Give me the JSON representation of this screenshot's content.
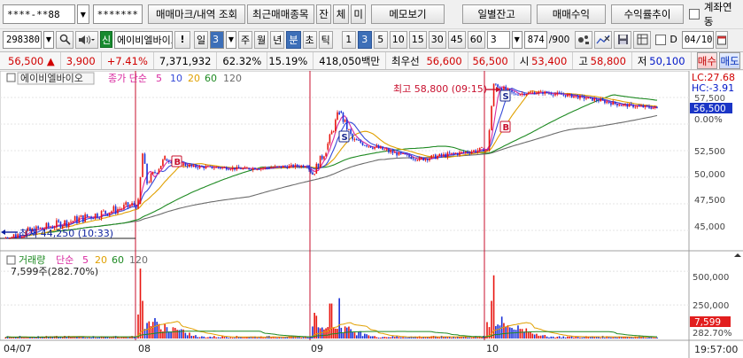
{
  "toolbar1": {
    "account": "****-**88",
    "password": "*******",
    "btn_trade_mark": "매매마크/내역 조회",
    "btn_recent": "최근매매종목",
    "btn_balance": "잔",
    "btn_conclusion": "체",
    "btn_unfilled": "미",
    "btn_memo": "메모보기",
    "btn_daily_balance": "일별잔고",
    "btn_trade_profit": "매매수익",
    "btn_profit_trend": "수익률추이",
    "account_link_label": "계좌연동"
  },
  "toolbar2": {
    "stock_code": "298380",
    "stock_badge": "신",
    "stock_name": "에이비엘바이오",
    "alert_btn": "!",
    "period_label": "일",
    "period_count": "3",
    "periods": [
      "주",
      "월",
      "년",
      "분",
      "초",
      "틱"
    ],
    "minute_values": [
      "1",
      "3",
      "5",
      "10",
      "15",
      "30",
      "45",
      "60"
    ],
    "selected_minute": "3",
    "tick_value": "3",
    "count_value": "874",
    "count_total": "/900",
    "d_label": "D",
    "date_value": "04/10"
  },
  "quote": {
    "price": "56,500",
    "change_arrow": "▲",
    "change": "3,900",
    "change_pct": "+7.41%",
    "volume": "7,371,932",
    "ratio1": "62.32%",
    "ratio2": "15.19%",
    "amount": "418,050백만",
    "best_ask_label": "최우선",
    "best_ask": "56,600",
    "best_bid": "56,500",
    "open_label": "시",
    "open": "53,400",
    "high_label": "고",
    "high": "58,800",
    "low_label": "저",
    "low": "50,100",
    "buy_btn": "매수",
    "sell_btn": "매도"
  },
  "price_panel": {
    "legend_name": "에이비엘바이오",
    "legend_ma": "종가 단순",
    "ma_periods": [
      "5",
      "10",
      "20",
      "60",
      "120"
    ],
    "lc": "LC:27.68",
    "hc": "HC:-3.91",
    "current_price_label": "56,500",
    "pct_label": "0.00%",
    "high_annotation": "최고 58,800 (09:15)",
    "low_annotation": "최저 44,250 (10:33)",
    "y_ticks": [
      "57,500",
      "52,500",
      "50,000",
      "47,500",
      "45,000"
    ]
  },
  "volume_panel": {
    "legend_name": "거래량",
    "legend_ma": "단순",
    "ma_periods": [
      "5",
      "20",
      "60",
      "120"
    ],
    "info": "7,599주(282.70%)",
    "y_ticks": [
      "500,000",
      "250,000"
    ],
    "current_label": "7,599",
    "pct_label": "282.70%"
  },
  "x_axis": {
    "labels": [
      "04/07",
      "08",
      "09",
      "10"
    ],
    "time_label": "19:57:00"
  },
  "colors": {
    "candle_up": "#e8150f",
    "candle_down": "#1a31d8",
    "ma5": "#d92aa0",
    "ma10": "#3449d8",
    "ma20": "#e0a000",
    "ma60": "#1e8a22",
    "ma120": "#6b6b6b",
    "day_separator": "#c8102e",
    "current_price_bg": "#1a35c6",
    "volume_current_bg": "#e21e1e"
  },
  "chart_data": {
    "type": "candlestick",
    "title": "",
    "price_series": [
      {
        "x": "04/07",
        "price": 44250
      },
      {
        "x": "04/08 09:00",
        "price": 47500
      },
      {
        "x": "04/08 09:10",
        "price": 52200
      },
      {
        "x": "04/08 09:20",
        "price": 49500
      },
      {
        "x": "04/08 10:00",
        "price": 51700
      },
      {
        "x": "04/08 11:00",
        "price": 51000
      },
      {
        "x": "04/08 13:00",
        "price": 50800
      },
      {
        "x": "04/08 15:20",
        "price": 51100
      },
      {
        "x": "04/09 09:00",
        "price": 50300
      },
      {
        "x": "04/09 09:30",
        "price": 52600
      },
      {
        "x": "04/09 10:00",
        "price": 56200
      },
      {
        "x": "04/09 10:30",
        "price": 53500
      },
      {
        "x": "04/09 12:00",
        "price": 52300
      },
      {
        "x": "04/09 13:00",
        "price": 51700
      },
      {
        "x": "04/09 15:20",
        "price": 52600
      },
      {
        "x": "04/10 09:00",
        "price": 52500
      },
      {
        "x": "04/10 09:15",
        "price": 58800
      },
      {
        "x": "04/10 10:00",
        "price": 57800
      },
      {
        "x": "04/10 11:00",
        "price": 58000
      },
      {
        "x": "04/10 12:00",
        "price": 57700
      },
      {
        "x": "04/10 13:00",
        "price": 57300
      },
      {
        "x": "04/10 14:00",
        "price": 56800
      },
      {
        "x": "04/10 15:20",
        "price": 56500
      }
    ],
    "volume_series": [
      {
        "x": "04/08 09:05",
        "volume": 520000
      },
      {
        "x": "04/08 09:10",
        "volume": 280000
      },
      {
        "x": "04/09 09:40",
        "volume": 260000
      },
      {
        "x": "04/09 10:00",
        "volume": 300000
      },
      {
        "x": "04/10 09:10",
        "volume": 280000
      },
      {
        "x": "04/10 09:15",
        "volume": 470000
      },
      {
        "x": "04/10 15:20",
        "volume": 7599
      }
    ],
    "ylim": [
      43500,
      59500
    ],
    "volume_ylim": [
      0,
      580000
    ]
  }
}
